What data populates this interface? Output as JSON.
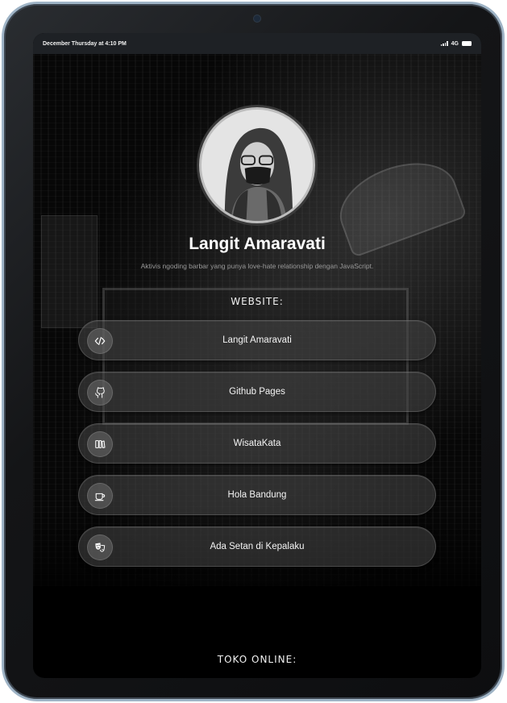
{
  "statusbar": {
    "datetime": "December Thursday at 4:10 PM",
    "network": "4G"
  },
  "profile": {
    "name": "Langit Amaravati",
    "bio": "Aktivis ngoding barbar yang punya love-hate relationship dengan JavaScript."
  },
  "sections": {
    "website_title": "WEBSITE:",
    "store_title": "TOKO ONLINE:"
  },
  "links": [
    {
      "label": "Langit Amaravati",
      "icon": "code-icon"
    },
    {
      "label": "Github Pages",
      "icon": "github-icon"
    },
    {
      "label": "WisataKata",
      "icon": "books-icon"
    },
    {
      "label": "Hola Bandung",
      "icon": "coffee-cup-icon"
    },
    {
      "label": "Ada Setan di Kepalaku",
      "icon": "theater-masks-icon"
    }
  ],
  "colors": {
    "device_frame": "#9fb4c6",
    "screen_bg": "#000000",
    "button_bg": "#464646",
    "text_primary": "#ffffff",
    "text_muted": "#9a9a9a"
  }
}
